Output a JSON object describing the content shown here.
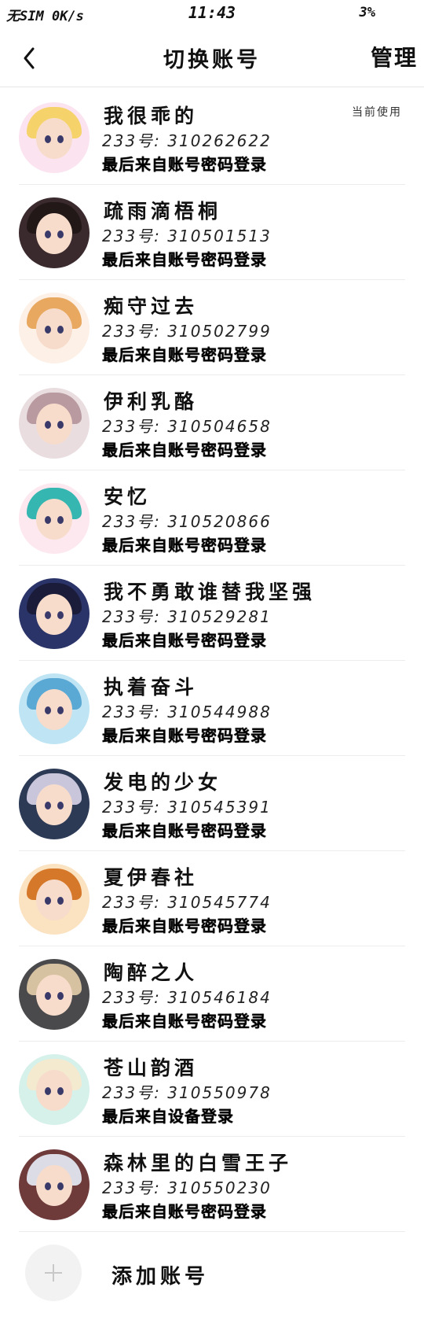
{
  "status_bar": {
    "carrier": "无SIM 0K/s",
    "time": "11:43",
    "battery": "3%"
  },
  "nav": {
    "title": "切换账号",
    "manage_label": "管理"
  },
  "accounts": [
    {
      "name": "我很乖的",
      "uid": "233号: 310262622",
      "last_login": "最后来自账号密码登录",
      "current_label": "当前使用",
      "colors": {
        "bg": "#fbe3f0",
        "hair": "#f6d36a"
      }
    },
    {
      "name": "疏雨滴梧桐",
      "uid": "233号: 310501513",
      "last_login": "最后来自账号密码登录",
      "colors": {
        "bg": "#3a2a2e",
        "hair": "#231818"
      }
    },
    {
      "name": "痴守过去",
      "uid": "233号: 310502799",
      "last_login": "最后来自账号密码登录",
      "colors": {
        "bg": "#fdf0e6",
        "hair": "#e8a860"
      }
    },
    {
      "name": "伊利乳酪",
      "uid": "233号: 310504658",
      "last_login": "最后来自账号密码登录",
      "colors": {
        "bg": "#e9dde0",
        "hair": "#b89aa0"
      }
    },
    {
      "name": "安忆",
      "uid": "233号: 310520866",
      "last_login": "最后来自账号密码登录",
      "colors": {
        "bg": "#fde8ef",
        "hair": "#35b6b0"
      }
    },
    {
      "name": "我不勇敢谁替我坚强",
      "uid": "233号: 310529281",
      "last_login": "最后来自账号密码登录",
      "colors": {
        "bg": "#2b3468",
        "hair": "#1b1b3a"
      }
    },
    {
      "name": "执着奋斗",
      "uid": "233号: 310544988",
      "last_login": "最后来自账号密码登录",
      "colors": {
        "bg": "#bfe4f4",
        "hair": "#5aa8d4"
      }
    },
    {
      "name": "发电的少女",
      "uid": "233号: 310545391",
      "last_login": "最后来自账号密码登录",
      "colors": {
        "bg": "#2c3a56",
        "hair": "#c9c6dc"
      }
    },
    {
      "name": "夏伊春社",
      "uid": "233号: 310545774",
      "last_login": "最后来自账号密码登录",
      "colors": {
        "bg": "#fbe2c0",
        "hair": "#d5782a"
      }
    },
    {
      "name": "陶醉之人",
      "uid": "233号: 310546184",
      "last_login": "最后来自账号密码登录",
      "colors": {
        "bg": "#4a4a4c",
        "hair": "#d6c2a0"
      }
    },
    {
      "name": "苍山韵酒",
      "uid": "233号: 310550978",
      "last_login": "最后来自设备登录",
      "colors": {
        "bg": "#d6f0ea",
        "hair": "#f4ead0"
      }
    },
    {
      "name": "森林里的白雪王子",
      "uid": "233号: 310550230",
      "last_login": "最后来自账号密码登录",
      "colors": {
        "bg": "#6e3a3a",
        "hair": "#dcdce6"
      }
    }
  ],
  "add_account": {
    "label": "添加账号"
  }
}
